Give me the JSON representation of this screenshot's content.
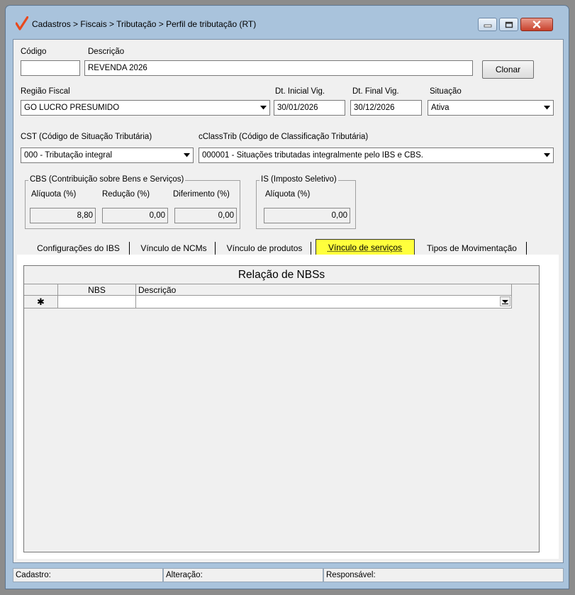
{
  "window": {
    "title": "Cadastros > Fiscais > Tributação > Perfil de tributação (RT)",
    "accent_color": "#e8491d",
    "close_color": "#c8412c"
  },
  "form": {
    "codigo_label": "Código",
    "codigo_value": "",
    "descricao_label": "Descrição",
    "descricao_value": "REVENDA 2026",
    "clonar_label": "Clonar",
    "regiao_label": "Região Fiscal",
    "regiao_value": "GO LUCRO PRESUMIDO",
    "dt_inicial_label": "Dt. Inicial Vig.",
    "dt_inicial_value": "30/01/2026",
    "dt_final_label": "Dt. Final Vig.",
    "dt_final_value": "30/12/2026",
    "situacao_label": "Situação",
    "situacao_value": "Ativa",
    "cst_label": "CST (Código de Situação Tributária)",
    "cst_value": "000 - Tributação integral",
    "cclass_label": "cClassTrib (Código de Classificação Tributária)",
    "cclass_value": "000001 - Situações tributadas integralmente pelo IBS e CBS."
  },
  "cbs": {
    "title": "CBS (Contribuição sobre Bens e Serviços)",
    "aliquota_label": "Alíquota (%)",
    "aliquota_value": "8,80",
    "reducao_label": "Redução (%)",
    "reducao_value": "0,00",
    "diferimento_label": "Diferimento (%)",
    "diferimento_value": "0,00"
  },
  "is": {
    "title": "IS (Imposto Seletivo)",
    "aliquota_label": "Alíquota (%)",
    "aliquota_value": "0,00"
  },
  "tabs": [
    {
      "label": "Configurações do IBS"
    },
    {
      "label": "Vínculo de NCMs"
    },
    {
      "label": "Vínculo de produtos"
    },
    {
      "label": "Vínculo de serviços",
      "active": true,
      "highlight_color": "#ffff3c"
    },
    {
      "label": "Tipos de Movimentação"
    }
  ],
  "grid": {
    "caption": "Relação de NBSs",
    "columns": [
      "NBS",
      "Descrição"
    ],
    "new_row_marker": "✱"
  },
  "status": {
    "cadastro_label": "Cadastro:",
    "alteracao_label": "Alteração:",
    "responsavel_label": "Responsável:"
  }
}
